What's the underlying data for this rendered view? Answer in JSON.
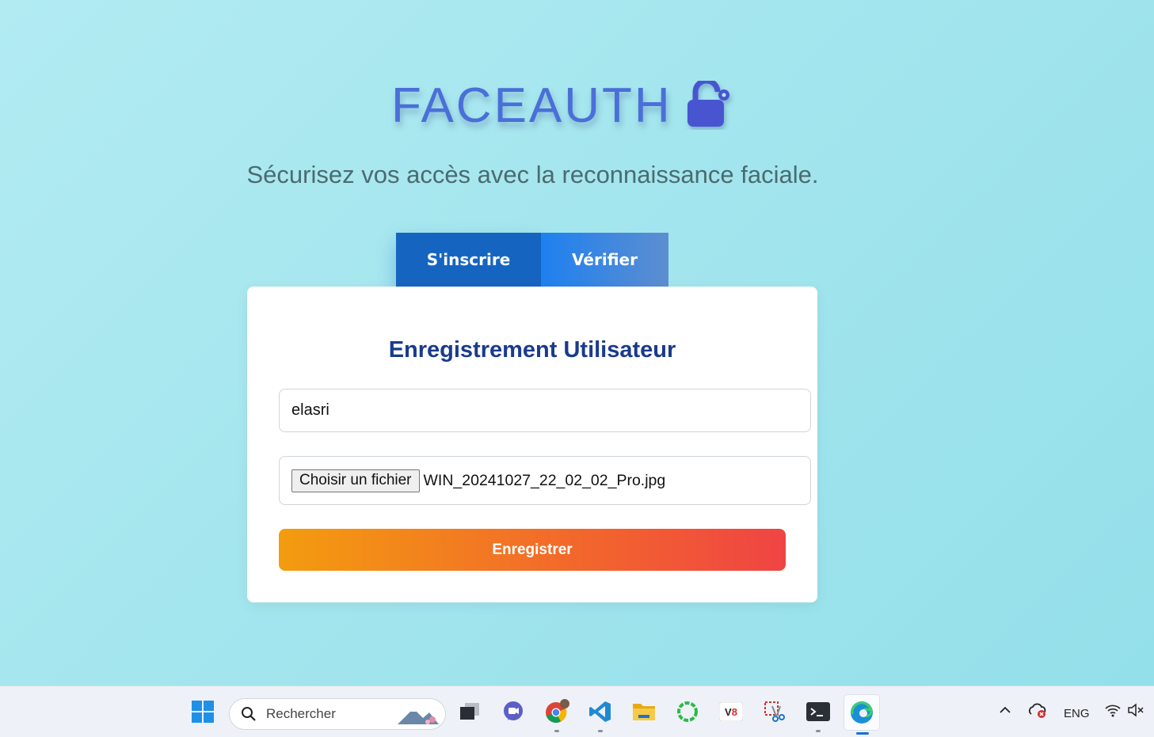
{
  "header": {
    "title": "FACEAUTH",
    "subtitle": "Sécurisez vos accès avec la reconnaissance faciale.",
    "icon": "lock-icon"
  },
  "tabs": [
    {
      "label": "S'inscrire",
      "active": true
    },
    {
      "label": "Vérifier",
      "active": false
    }
  ],
  "form": {
    "title": "Enregistrement Utilisateur",
    "name_value": "elasri",
    "file_button": "Choisir un fichier",
    "file_name": "WIN_20241027_22_02_02_Pro.jpg",
    "submit_label": "Enregistrer"
  },
  "taskbar": {
    "search_placeholder": "Rechercher",
    "apps": [
      "windows-start-icon",
      "task-view-icon",
      "teams-icon",
      "chrome-icon",
      "vscode-icon",
      "file-explorer-icon",
      "app-ring-icon",
      "app-v8-icon",
      "snipping-tool-icon",
      "terminal-icon",
      "edge-icon"
    ],
    "tray_language": "ENG"
  },
  "colors": {
    "title": "#4a6fd8",
    "tab_active": "#1565c0",
    "card_title": "#1a3b8c",
    "submit_start": "#f39c0f",
    "submit_end": "#ef4444"
  }
}
